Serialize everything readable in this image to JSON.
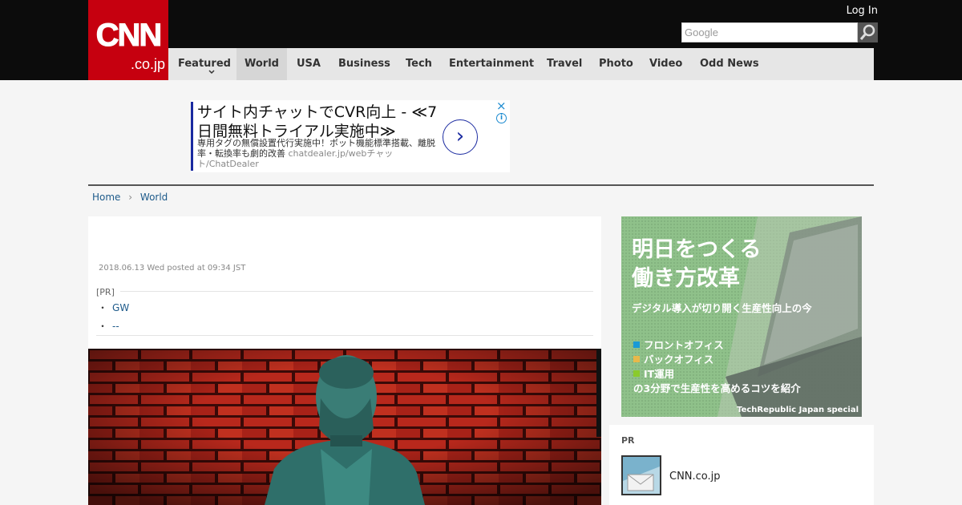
{
  "header": {
    "logo_text": "CNN",
    "logo_domain": ".co.jp",
    "login_label": "Log In",
    "search_placeholder": "Google"
  },
  "nav": {
    "items": [
      "Featured",
      "World",
      "USA",
      "Business",
      "Tech",
      "Entertainment",
      "Travel",
      "Photo",
      "Video",
      "Odd News"
    ],
    "active": "World"
  },
  "ad": {
    "headline": "サイト内チャットでCVR向上 - ≪7日間無料トライアル実施中≫",
    "description": "専用タグの無償設置代行実施中！ボット機能標準搭載、離脱率・転換率も劇的改善",
    "url": "chatdealer.jp/webチャット/ChatDealer",
    "close_icon": "×",
    "info_icon": "i",
    "arrow_icon": "›"
  },
  "breadcrumb": {
    "home": "Home",
    "current": "World"
  },
  "article": {
    "date": "2018.06.13 Wed posted at 09:34 JST",
    "pr_label": "[PR]",
    "pr_links": [
      "GW",
      "--"
    ],
    "photo_caption_icon": "statue-photo"
  },
  "side_ad": {
    "title_line1": "明日をつくる",
    "title_line2": "働き方改革",
    "subtitle": "デジタル導入が切り開く生産性向上の今",
    "items": [
      "フロントオフィス",
      "バックオフィス",
      "IT運用",
      "の3分野で生産性を高めるコツを紹介"
    ],
    "footer": "TechRepublic Japan special",
    "colors": {
      "bg": "#8fc18a",
      "sq1": "#1a9ad6",
      "sq2": "#e8b84a",
      "sq3": "#8acb2c"
    }
  },
  "pr_box": {
    "title": "PR",
    "name": "CNN.co.jp"
  },
  "colors": {
    "brand": "#c6000f",
    "topbar": "#0c0c0c",
    "link": "#1d5a8a"
  }
}
